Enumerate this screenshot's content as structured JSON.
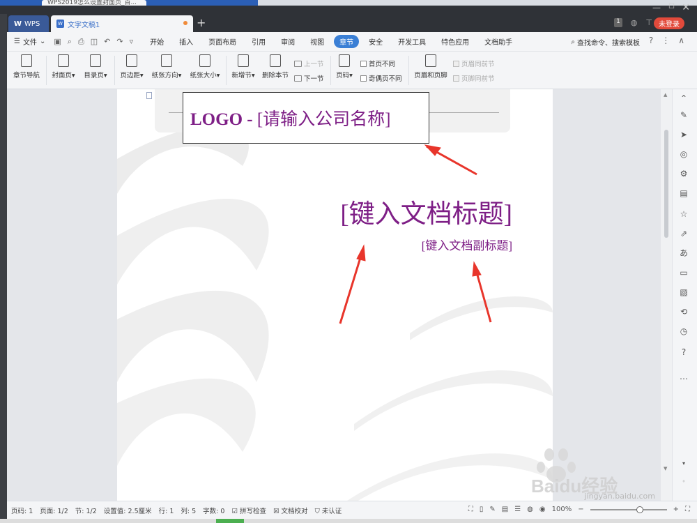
{
  "browser": {
    "tabs": [
      "WPS2019怎么设置封面页_百..."
    ]
  },
  "titlebar": {
    "wps_tab": "WPS",
    "doc_tab": "文字文稿1",
    "new_tab": "+",
    "badge": "1",
    "login": "未登录"
  },
  "menu": {
    "file": "文件",
    "items": [
      "开始",
      "插入",
      "页面布局",
      "引用",
      "审阅",
      "视图",
      "章节",
      "安全",
      "开发工具",
      "特色应用",
      "文档助手"
    ],
    "active_index": 6,
    "search": "查找命令、搜索模板"
  },
  "ribbon": {
    "nav": "章节导航",
    "cover": "封面页",
    "toc": "目录页",
    "margin": "页边距",
    "orientation": "纸张方向",
    "size": "纸张大小",
    "new_section": "新增节",
    "delete_section": "删除本节",
    "prev": "上一节",
    "next": "下一节",
    "page_num": "页码",
    "first_diff": "首页不同",
    "odd_even_diff": "奇偶页不同",
    "header_footer": "页眉和页脚",
    "header_same": "页眉同前节",
    "footer_same": "页脚同前节"
  },
  "document": {
    "logo_bold": "LOGO -",
    "logo_company": "[请输入公司名称]",
    "title": "[键入文档标题]",
    "subtitle": "[键入文档副标题]"
  },
  "statusbar": {
    "page_num": "页码: 1",
    "pages": "页面: 1/2",
    "section": "节: 1/2",
    "setting": "设置值: 2.5厘米",
    "row": "行: 1",
    "col": "列: 5",
    "words": "字数: 0",
    "spell": "拼写检查",
    "proof": "文档校对",
    "cert": "未认证",
    "zoom": "100%"
  },
  "watermark": {
    "brand": "Baidu经验",
    "url": "jingyan.baidu.com"
  },
  "colors": {
    "accent": "#3a7fd5",
    "title_purple": "#7e1f86",
    "annotation_red": "#e8352b",
    "login_red": "#e24a3b"
  }
}
